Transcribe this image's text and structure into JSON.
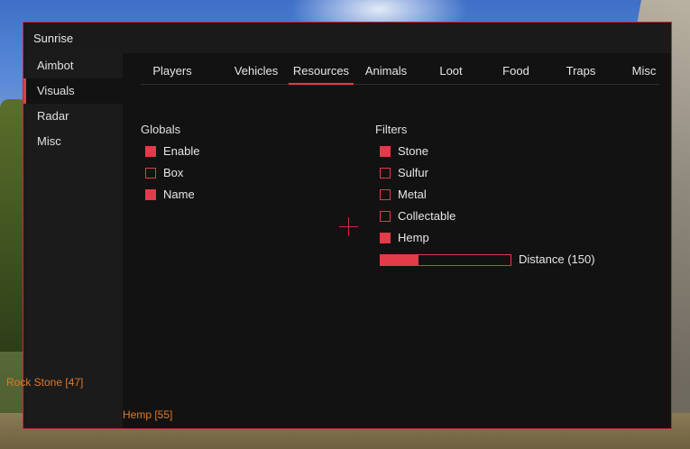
{
  "window": {
    "title": "Sunrise"
  },
  "sidebar": {
    "items": [
      {
        "label": "Aimbot",
        "active": false
      },
      {
        "label": "Visuals",
        "active": true
      },
      {
        "label": "Radar",
        "active": false
      },
      {
        "label": "Misc",
        "active": false
      }
    ]
  },
  "tabs": [
    {
      "label": "Players",
      "active": false
    },
    {
      "label": "Vehicles",
      "active": false
    },
    {
      "label": "Resources",
      "active": true
    },
    {
      "label": "Animals",
      "active": false
    },
    {
      "label": "Loot",
      "active": false
    },
    {
      "label": "Food",
      "active": false
    },
    {
      "label": "Traps",
      "active": false
    },
    {
      "label": "Misc",
      "active": false
    }
  ],
  "globals": {
    "heading": "Globals",
    "options": [
      {
        "label": "Enable",
        "checked": true
      },
      {
        "label": "Box",
        "checked": false
      },
      {
        "label": "Name",
        "checked": true
      }
    ]
  },
  "filters": {
    "heading": "Filters",
    "options": [
      {
        "label": "Stone",
        "checked": true
      },
      {
        "label": "Sulfur",
        "checked": false
      },
      {
        "label": "Metal",
        "checked": false
      },
      {
        "label": "Collectable",
        "checked": false
      },
      {
        "label": "Hemp",
        "checked": true
      }
    ],
    "distance": {
      "label": "Distance (150)",
      "fill_fraction": 0.29
    }
  },
  "esp_labels": {
    "rock_stone": "Rock Stone [47]",
    "hemp": "Hemp [55]"
  },
  "colors": {
    "accent": "#e23b4a",
    "panel_bg": "#121212",
    "sidebar_bg": "#1b1b1b",
    "esp_text": "#e07a2a"
  }
}
